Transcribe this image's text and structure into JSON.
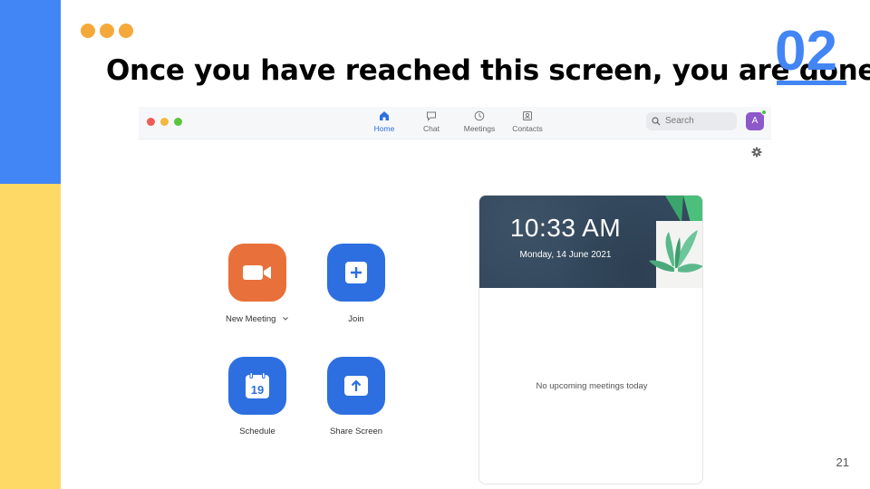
{
  "slide": {
    "title": "Once you have reached this screen, you are done!",
    "number": "02",
    "page": "21"
  },
  "zoom": {
    "nav": [
      {
        "label": "Home",
        "icon": "home-icon",
        "active": true
      },
      {
        "label": "Chat",
        "icon": "chat-icon",
        "active": false
      },
      {
        "label": "Meetings",
        "icon": "clock-icon",
        "active": false
      },
      {
        "label": "Contacts",
        "icon": "contacts-icon",
        "active": false
      }
    ],
    "search_placeholder": "Search",
    "avatar_initial": "A",
    "actions": {
      "new_meeting": "New Meeting",
      "join": "Join",
      "schedule": "Schedule",
      "schedule_day": "19",
      "share_screen": "Share Screen"
    },
    "card": {
      "time": "10:33 AM",
      "date": "Monday, 14 June 2021",
      "empty": "No upcoming meetings today"
    }
  },
  "colors": {
    "accent_blue": "#4285f4",
    "accent_yellow": "#ffd966",
    "dot_orange": "#f6a93b",
    "zoom_blue": "#2d6fe0",
    "zoom_orange": "#e8703a"
  }
}
